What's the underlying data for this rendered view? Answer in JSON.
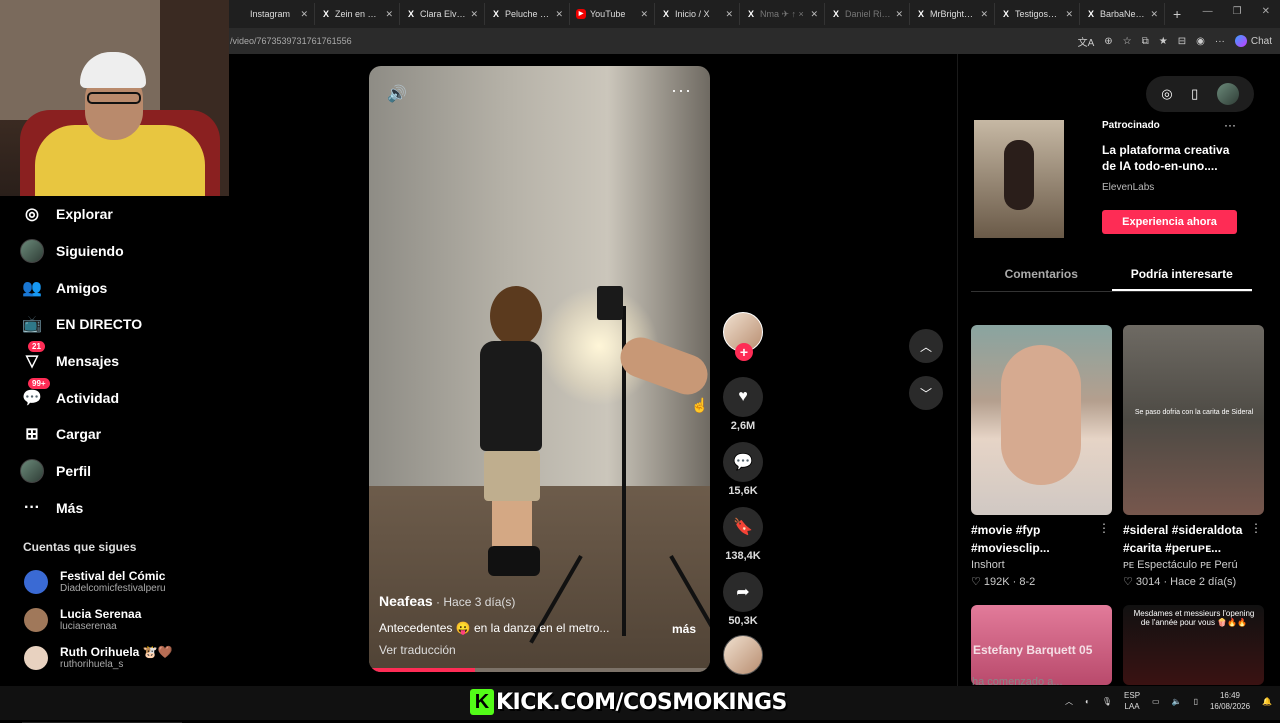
{
  "browser": {
    "tabs": [
      {
        "label": "Instagram",
        "icon": "instagram-icon",
        "glyph": ""
      },
      {
        "label": "Zein en X: \"V",
        "icon": "x-icon",
        "glyph": "X"
      },
      {
        "label": "Clara Elvira O",
        "icon": "x-icon",
        "glyph": "X"
      },
      {
        "label": "Peluche Calig",
        "icon": "x-icon",
        "glyph": "X"
      },
      {
        "label": "YouTube",
        "icon": "youtube-icon",
        "glyph": "▶"
      },
      {
        "label": "Inicio / X",
        "icon": "x-icon",
        "glyph": "X"
      },
      {
        "label": "Nma ✈ ↑ ×",
        "icon": "x-icon",
        "glyph": "X"
      },
      {
        "label": "Daniel Rivera",
        "icon": "x-icon",
        "glyph": "X"
      },
      {
        "label": "MrBrightSide",
        "icon": "x-icon",
        "glyph": "X"
      },
      {
        "label": "Testigosdeca",
        "icon": "x-icon",
        "glyph": "X"
      },
      {
        "label": "BarbaNegra",
        "icon": "x-icon",
        "glyph": "X"
      }
    ],
    "url": "/video/7673539731761761556",
    "chat_label": "Chat"
  },
  "sidebar": {
    "items": [
      {
        "label": "Explorar",
        "icon": "compass-icon",
        "glyph": "◎",
        "badge": ""
      },
      {
        "label": "Siguiendo",
        "icon": "following-avatar-icon",
        "glyph": "",
        "badge": ""
      },
      {
        "label": "Amigos",
        "icon": "friends-icon",
        "glyph": "👥",
        "badge": ""
      },
      {
        "label": "EN DIRECTO",
        "icon": "live-tv-icon",
        "glyph": "📺",
        "badge": ""
      },
      {
        "label": "Mensajes",
        "icon": "send-icon",
        "glyph": "▽",
        "badge": "21"
      },
      {
        "label": "Actividad",
        "icon": "activity-icon",
        "glyph": "💬",
        "badge": "99+"
      },
      {
        "label": "Cargar",
        "icon": "upload-icon",
        "glyph": "⊞",
        "badge": ""
      },
      {
        "label": "Perfil",
        "icon": "profile-avatar-icon",
        "glyph": "",
        "badge": ""
      },
      {
        "label": "Más",
        "icon": "more-icon",
        "glyph": "···",
        "badge": ""
      }
    ],
    "follows_title": "Cuentas que sigues",
    "follows": [
      {
        "name": "Festival del Cómic",
        "handle": "Diadelcomicfestivalperu",
        "color": "#3a6ad4"
      },
      {
        "name": "Lucia Serenaa",
        "handle": "luciaserenaa",
        "color": "#a0785a"
      },
      {
        "name": "Ruth Orihuela 🐮🤎",
        "handle": "ruthorihuela_s",
        "color": "#e8d2c0"
      }
    ]
  },
  "video": {
    "username": "Neafeas",
    "time": " · Hace 3 día(s)",
    "description": "Antecedentes 😛 en la danza en el metro...",
    "more": "más",
    "translate": "Ver traducción",
    "progress": 0.31
  },
  "actions": {
    "likes": "2,6M",
    "comments": "15,6K",
    "saves": "138,4K",
    "shares": "50,3K"
  },
  "right_panel": {
    "ad": {
      "label": "Patrocinado",
      "title": "La plataforma creativa de IA todo-en-uno....",
      "brand": "ElevenLabs",
      "cta": "Experiencia ahora"
    },
    "tabs": [
      "Comentarios",
      "Podría interesarte"
    ],
    "cards": [
      {
        "caption": "#movie #fyp #moviesclip...",
        "author": "Inshort",
        "meta": "♡ 192K · 8-2"
      },
      {
        "caption": "#sideral #sideraldota #carita #peruᴘᴇ...",
        "author": "ᴘᴇ Espectáculo ᴘᴇ Perú",
        "meta": "♡ 3014 · Hace 2 día(s)",
        "thumb_text": "Se paso dofria con la carita de Sideral"
      },
      {
        "overlay": "Estefany Barquett 05"
      },
      {
        "overlay": "Mesdames et messieurs l'opening de l'année pour vous 🍿🔥🔥"
      }
    ],
    "partial_text": "ha comenzado a..."
  },
  "overlay": {
    "kick_text": "KICK.COM/COSMOKINGS"
  },
  "tray": {
    "lang": "ESP",
    "lang2": "LAA",
    "time": "16:49",
    "date": "16/08/2026"
  }
}
